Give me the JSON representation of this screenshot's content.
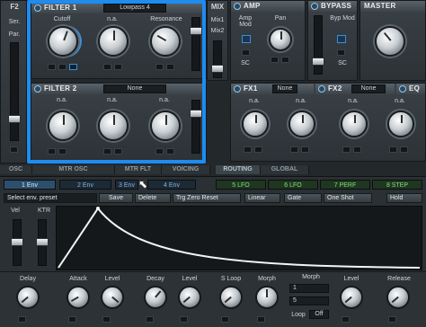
{
  "filter1": {
    "title": "FILTER 1",
    "type": "Lowpass 4",
    "labels": [
      "Cutoff",
      "n.a.",
      "Resonance"
    ]
  },
  "filter2": {
    "title": "FILTER 2",
    "type": "None",
    "labels": [
      "n.a.",
      "n.a.",
      "n.a."
    ]
  },
  "left": {
    "f2": "F2",
    "ser": "Ser.",
    "par": "Par."
  },
  "mix": {
    "title": "MIX",
    "mix1": "Mix1",
    "mix2": "Mix2"
  },
  "amp": {
    "title": "AMP",
    "amp_mod": "Amp Mod",
    "pan": "Pan",
    "sc": "SC"
  },
  "bypass": {
    "title": "BYPASS",
    "byp_mod": "Byp Mod",
    "sc": "SC"
  },
  "master": {
    "title": "MASTER"
  },
  "fx": {
    "fx1": "FX1",
    "fx1_sel": "None",
    "fx2": "FX2",
    "fx2_sel": "None",
    "eq": "EQ",
    "labels": [
      "n.a.",
      "n.a.",
      "n.a.",
      "n.a."
    ]
  },
  "tabs": [
    "OSC",
    "MTR OSC",
    "MTR FLT",
    "VOICING",
    "ROUTING",
    "GLOBAL"
  ],
  "env_tabs": [
    "1 Env",
    "2 Env",
    "3 Env",
    "4 Env",
    "5 LFO",
    "6 LFO",
    "7 PERF",
    "8 STEP"
  ],
  "toolbar": {
    "preset": "Select env. preset",
    "save": "Save",
    "delete": "Delete",
    "trg_zero": "Trg Zero Reset",
    "linear": "Linear",
    "gate": "Gate",
    "one_shot": "One Shot",
    "hold": "Hold"
  },
  "env_left": {
    "vel": "Vel",
    "ktr": "KTR"
  },
  "bottom": {
    "delay": "Delay",
    "attack": "Attack",
    "level1": "Level",
    "decay": "Decay",
    "level2": "Level",
    "s_loop": "S Loop",
    "morph": "Morph",
    "morph_title": "Morph",
    "morph_val1": "1",
    "morph_val2": "5",
    "loop": "Loop",
    "loop_val": "Off",
    "level3": "Level",
    "release": "Release"
  }
}
